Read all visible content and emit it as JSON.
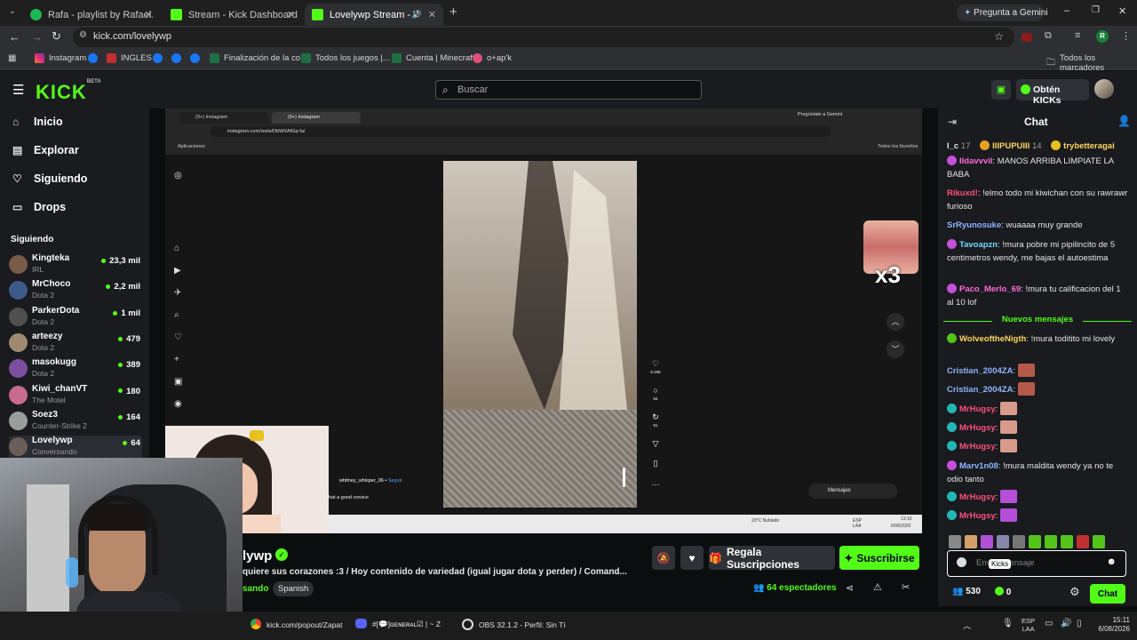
{
  "browser": {
    "tabs": [
      {
        "title": "Rafa - playlist by Rafael.xared |",
        "active": false
      },
      {
        "title": "Stream - Kick Dashboard",
        "active": false
      },
      {
        "title": "Lovelywp Stream - Watch L",
        "active": true
      }
    ],
    "gemini_button": "Pregunta a Gemini",
    "url": "kick.com/lovelywp",
    "bookmarks": [
      "Instagram",
      "INGLES",
      "Finalización de la co...",
      "Todos los juegos |...",
      "Cuenta | Minecraft",
      "o+ap'k"
    ],
    "bookmarks_folder": "Todos los marcadores",
    "profile_initial": "R"
  },
  "kick": {
    "logo": "KICK",
    "logo_tag": "BETA",
    "search_placeholder": "Buscar",
    "get_kicks": "Obtén KICKs"
  },
  "nav": {
    "items": [
      {
        "label": "Inicio",
        "icon": "home-icon"
      },
      {
        "label": "Explorar",
        "icon": "compass-icon"
      },
      {
        "label": "Siguiendo",
        "icon": "heart-icon"
      },
      {
        "label": "Drops",
        "icon": "drops-icon"
      }
    ],
    "following_title": "Siguiendo",
    "channels": [
      {
        "name": "Kingteka",
        "game": "IRL",
        "viewers": "23,3 mil",
        "color": "#7a5b47"
      },
      {
        "name": "MrChoco",
        "game": "Dota 2",
        "viewers": "2,2 mil",
        "color": "#3c5a8a"
      },
      {
        "name": "ParkerDota",
        "game": "Dota 2",
        "viewers": "1 mil",
        "color": "#4f4f4f"
      },
      {
        "name": "arteezy",
        "game": "Dota 2",
        "viewers": "479",
        "color": "#a08a6f"
      },
      {
        "name": "masokugg",
        "game": "Dota 2",
        "viewers": "389",
        "color": "#7e4fa0"
      },
      {
        "name": "Kiwi_chanVT",
        "game": "The Motel",
        "viewers": "180",
        "color": "#c96a8f"
      },
      {
        "name": "Soez3",
        "game": "Counter-Strike 2",
        "viewers": "164",
        "color": "#9c9c9c"
      },
      {
        "name": "Lovelywp",
        "game": "Conversando",
        "viewers": "64",
        "color": "#6b5d57"
      }
    ]
  },
  "video": {
    "inner_tabs": [
      "(9+) Instagram",
      "(9+) Instagram"
    ],
    "inner_gemini": "Pregúntale a Gemini",
    "inner_url": "instagram.com/reels/DbWXAfGq-fa/",
    "inner_apps": "Aplicaciones",
    "inner_favorites": "Todos los favoritos",
    "reel_user": "whitney_whisper_06",
    "reel_follow": "Seguir",
    "reel_caption": "hat a good crevice",
    "reel_likes": "5.195",
    "reel_comments": "54",
    "reel_reposts": "61",
    "overlay_multiplier": "x3",
    "messages_label": "Mensajes",
    "inner_weather": "23°C Nublado",
    "inner_lang": "ESP LAA",
    "inner_time": "13:16",
    "inner_date": "6/08/2026"
  },
  "stream": {
    "name": "lywp",
    "title": "quiere sus corazones :3 / Hoy contenido de variedad (igual jugar dota y perder) / Comand...",
    "category": "sando",
    "language_tag": "Spanish",
    "gift_button": "Regala Suscripciones",
    "subscribe_button": "Suscribirse",
    "viewers": "64",
    "viewers_label": "espectadores"
  },
  "chat": {
    "title": "Chat",
    "top_gifters": [
      {
        "name": "l_c",
        "count": "17"
      },
      {
        "name": "IIIPUPUIII",
        "count": "14"
      },
      {
        "name": "trybetteragai",
        "count": ""
      }
    ],
    "messages": [
      {
        "user": "IIdavvvil",
        "color": "#ff6ad5",
        "text": "MANOS ARRIBA LIMPIATE LA BABA",
        "badge": "#c44fd8"
      },
      {
        "user": "Rikuxd!",
        "color": "#ff4f7b",
        "text": "!elmo todo mi kiwichan con su rawrawr furioso",
        "badge": ""
      },
      {
        "user": "SrRyunosuke",
        "color": "#8fb4ff",
        "text": "wuaaaa muy grande",
        "badge": ""
      },
      {
        "user": "Tavoapzn",
        "color": "#74d8ff",
        "text": "!mura pobre mi pipilincito de 5 centimetros wendy, me bajas el autoestima",
        "badge": "#c44fd8"
      },
      {
        "user": "Paco_Merlo_69",
        "color": "#ff6ad5",
        "text": "!mura tu calificacion del 1 al 10 lof",
        "badge": "#c44fd8"
      }
    ],
    "new_messages_label": "Nuevos mensajes",
    "messages_after": [
      {
        "user": "WolveoftheNigth",
        "color": "#ffd65a",
        "text": "!mura toditito mi lovely",
        "badge": "#53c41a"
      },
      {
        "user": "Cristian_2004ZA",
        "color": "#8fb4ff",
        "text": "",
        "badge": "",
        "emote": "#b55a4a"
      },
      {
        "user": "Cristian_2004ZA",
        "color": "#8fb4ff",
        "text": "",
        "badge": "",
        "emote": "#b55a4a"
      },
      {
        "user": "MrHugsy",
        "color": "#ff4f7b",
        "text": "",
        "badge": "#22b7b7",
        "emote": "#d99b8b"
      },
      {
        "user": "MrHugsy",
        "color": "#ff4f7b",
        "text": "",
        "badge": "#22b7b7",
        "emote": "#d99b8b"
      },
      {
        "user": "MrHugsy",
        "color": "#ff4f7b",
        "text": "",
        "badge": "#22b7b7",
        "emote": "#d99b8b"
      },
      {
        "user": "Marv1n08",
        "color": "#8fb4ff",
        "text": "!mura maldita wendy ya no te odio tanto",
        "badge": "#c44fd8"
      },
      {
        "user": "MrHugsy",
        "color": "#ff4f7b",
        "text": "",
        "badge": "#22b7b7",
        "emote": "#b34fd8"
      },
      {
        "user": "MrHugsy",
        "color": "#ff4f7b",
        "text": "",
        "badge": "#22b7b7",
        "emote": "#b34fd8"
      }
    ],
    "input_placeholder": "Enviar mensaje",
    "kicks_tooltip": "Kicks",
    "points": "530",
    "kicks_balance": "0",
    "send_button": "Chat"
  },
  "taskbar": {
    "items": [
      "kick.com/popout/Zapat",
      "#[💬]ɢᴇɴᴇʀᴀʟ☑ | ~ Z",
      "OBS 32.1.2 - Perfil: Sin Tí"
    ],
    "lang": "ESP",
    "lang2": "LAA",
    "time": "15:11",
    "date": "6/08/2026"
  },
  "colors": {
    "kick_green": "#53fc18",
    "bg": "#0b0e0f",
    "panel": "#191b1f"
  }
}
